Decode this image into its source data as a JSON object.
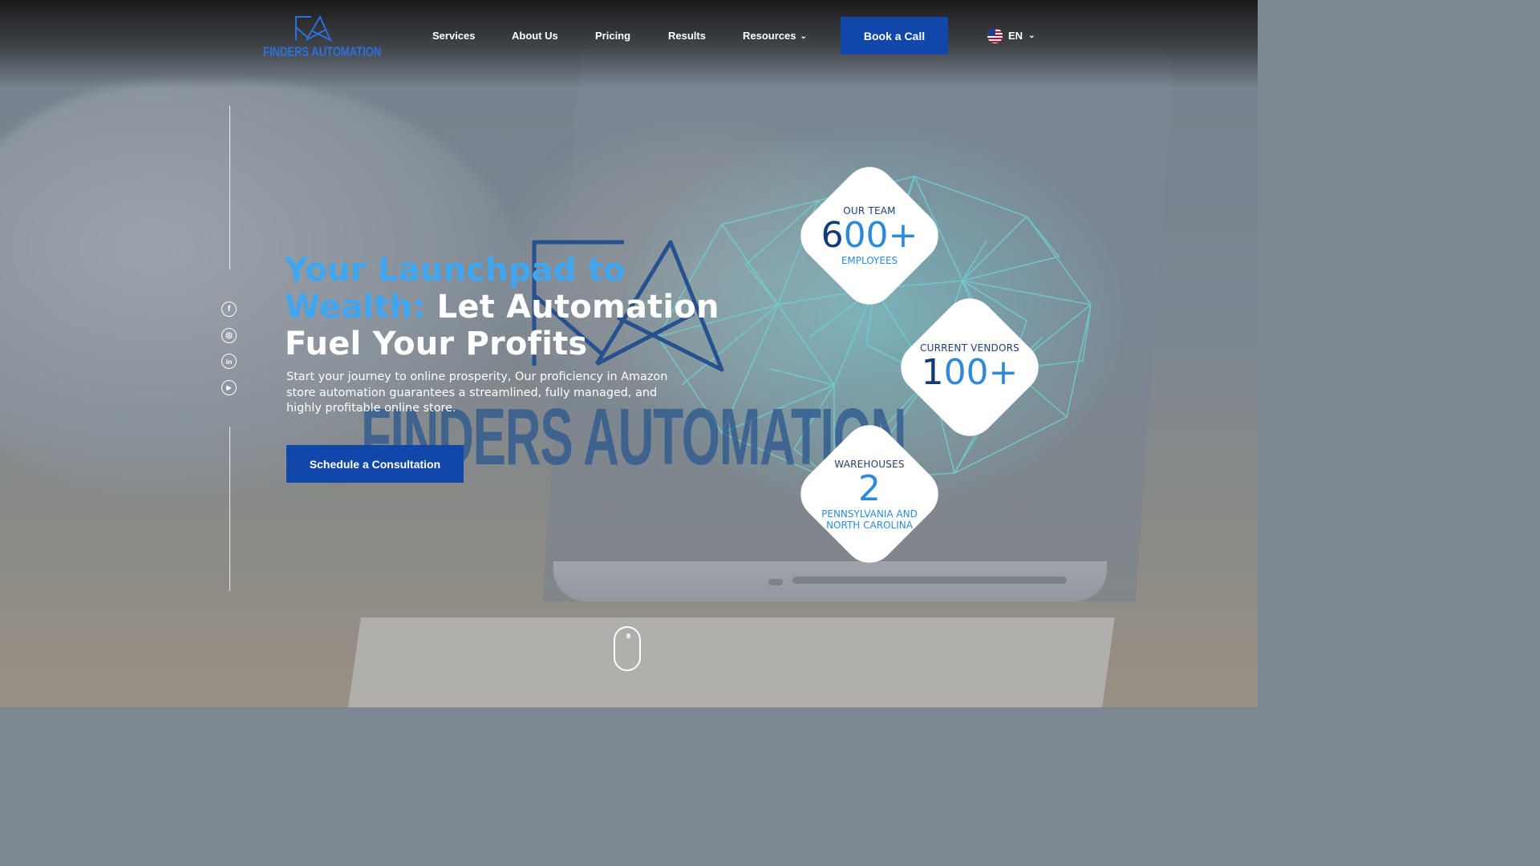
{
  "header": {
    "logo_text": "FINDERS AUTOMATION",
    "nav": [
      {
        "label": "Services"
      },
      {
        "label": "About Us"
      },
      {
        "label": "Pricing"
      },
      {
        "label": "Results"
      },
      {
        "label": "Resources"
      }
    ],
    "book_call_label": "Book a Call",
    "language": "EN"
  },
  "social": {
    "facebook": "f",
    "instagram": "◎",
    "linkedin": "in",
    "youtube": "▶"
  },
  "hero": {
    "title_accent": "Your Launchpad to Wealth:",
    "title_rest": " Let Automation Fuel Your Profits",
    "subtitle": "Start your journey to online prosperity, Our proficiency in Amazon store automation guarantees a streamlined, fully managed, and highly profitable online store.",
    "cta_label": "Schedule a Consultation",
    "watermark_text": "FINDERS AUTOMATION"
  },
  "stats": [
    {
      "label": "OUR TEAM",
      "value_lead": "6",
      "value_rest": "00+",
      "sub": "EMPLOYEES"
    },
    {
      "label": "CURRENT VENDORS",
      "value_lead": "1",
      "value_rest": "00+",
      "sub": ""
    },
    {
      "label": "WAREHOUSES",
      "value_lead": "",
      "value_rest": "2",
      "sub": "PENNSYLVANIA AND NORTH CAROLINA"
    }
  ],
  "colors": {
    "brand_blue": "#1147a8",
    "accent_light_blue": "#40a6ef",
    "stat_blue": "#2e8ad8",
    "stat_navy": "#123a7b"
  }
}
